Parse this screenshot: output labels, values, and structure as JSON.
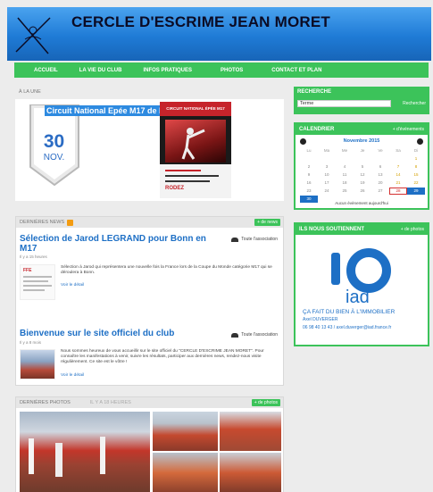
{
  "site": {
    "title": "CERCLE D'ESCRIME JEAN MORET"
  },
  "nav": {
    "items": [
      "ACCUEIL",
      "LA VIE DU CLUB",
      "INFOS PRATIQUES",
      "PHOTOS",
      "CONTACT ET PLAN"
    ]
  },
  "une": {
    "heading": "À LA UNE",
    "title": "Circuit National Epée M17 de Rodez",
    "day": "30",
    "month": "NOV.",
    "poster": {
      "top": "CIRCUIT NATIONAL ÉPÉE M17",
      "city": "RODEZ"
    }
  },
  "news": {
    "heading": "DERNIÈRES NEWS",
    "more": "+ de news",
    "items": [
      {
        "title": "Sélection de Jarod LEGRAND pour Bonn en M17",
        "meta": "Il y a 15 heures",
        "assoc": "Toute l'association",
        "text": "Sélection à Jarod qui représentera une nouvelle fois la France lors de la Coupe du Monde catégorie M17 qui se déroulera à Bonn.",
        "link": "Voir le détail"
      },
      {
        "title": "Bienvenue sur le site officiel du club",
        "meta": "Il y a 8 mois",
        "assoc": "Toute l'association",
        "text": "Nous sommes heureux de vous accueillir sur le site officiel du \"CERCLE D'ESCRIME JEAN MORET\". Pour connaître les manifestations à venir, suivre les résultats, participer aux dernières news, rendez-nous visite régulièrement. Ce site est le vôtre !",
        "link": "Voir le détail"
      }
    ]
  },
  "photos": {
    "heading": "DERNIÈRES PHOTOS",
    "meta": "IL Y A 18 HEURES",
    "more": "+ de photos"
  },
  "search": {
    "heading": "RECHERCHE",
    "value": "Terme",
    "button": "Rechercher"
  },
  "calendar": {
    "heading": "CALENDRIER",
    "link": "+ d'événements",
    "month": "Novembre 2015",
    "days": [
      "Lu",
      "Ma",
      "Me",
      "Je",
      "Ve",
      "Sa",
      "Di"
    ],
    "weeks": [
      [
        "",
        "",
        "",
        "",
        "",
        "",
        "1"
      ],
      [
        "2",
        "3",
        "4",
        "5",
        "6",
        "7",
        "8"
      ],
      [
        "9",
        "10",
        "11",
        "12",
        "13",
        "14",
        "15"
      ],
      [
        "16",
        "17",
        "18",
        "19",
        "20",
        "21",
        "22"
      ],
      [
        "23",
        "24",
        "25",
        "26",
        "27",
        "28",
        "29"
      ],
      [
        "30",
        "",
        "",
        "",
        "",
        "",
        ""
      ]
    ],
    "today": "28",
    "selected": [
      "29",
      "30"
    ],
    "none": "Aucun évènement aujourd'hui"
  },
  "sponsor": {
    "heading": "ILS NOUS SOUTIENNENT",
    "link": "+ de photos",
    "brand": "iad",
    "slogan": "ÇA FAIT DU BIEN À L'IMMOBILIER",
    "name": "Axel DUVERGER",
    "contact": "06 98 40 13 43 / axel.duverger@iad.france.fr"
  },
  "colors": {
    "green": "#3cc35a",
    "blue": "#1d6fc5",
    "header": "#1f7bd6"
  }
}
